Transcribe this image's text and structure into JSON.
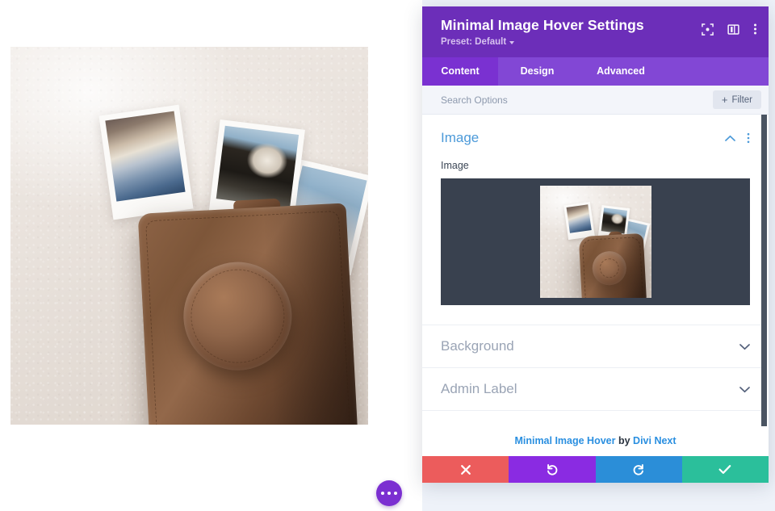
{
  "modal": {
    "title": "Minimal Image Hover Settings",
    "preset": "Preset: Default",
    "header_icons": [
      {
        "name": "focus-target-icon"
      },
      {
        "name": "layout-columns-icon"
      },
      {
        "name": "more-vertical-icon"
      }
    ],
    "tabs": [
      {
        "label": "Content",
        "active": true
      },
      {
        "label": "Design",
        "active": false
      },
      {
        "label": "Advanced",
        "active": false
      }
    ],
    "search": {
      "placeholder": "Search Options",
      "value": ""
    },
    "filter_button": {
      "label": "Filter",
      "plus": "+"
    },
    "sections": [
      {
        "title": "Image",
        "state": "expanded",
        "toggle_icon": "chevron-up-icon",
        "fields": [
          {
            "label": "Image",
            "type": "image-upload"
          }
        ]
      },
      {
        "title": "Background",
        "state": "collapsed",
        "toggle_icon": "chevron-down-icon"
      },
      {
        "title": "Admin Label",
        "state": "collapsed",
        "toggle_icon": "chevron-down-icon"
      }
    ],
    "credit": {
      "module_link": "Minimal Image Hover",
      "by": " by ",
      "vendor_link": "Divi Next"
    },
    "footer_buttons": [
      {
        "name": "cancel",
        "icon": "close-x-icon",
        "color": "#ec5c5c"
      },
      {
        "name": "undo",
        "icon": "undo-arrow-icon",
        "color": "#8a2be2"
      },
      {
        "name": "redo",
        "icon": "redo-arrow-icon",
        "color": "#2b8ed8"
      },
      {
        "name": "save",
        "icon": "checkmark-icon",
        "color": "#2bbf9b"
      }
    ]
  },
  "canvas": {
    "hero_image_alt": "Brown leather camera case with polaroid photos on a pale marble surface",
    "fab": {
      "icon": "ellipsis-horizontal-icon",
      "color": "#7b2fd1"
    }
  },
  "colors": {
    "header_purple": "#6c2eb9",
    "tab_bar_purple": "#8247d5",
    "active_tab_purple": "#7a31d1",
    "section_link_blue": "#4c9ad9",
    "preview_dark": "#39414f",
    "page_background": "#eef2f9"
  }
}
